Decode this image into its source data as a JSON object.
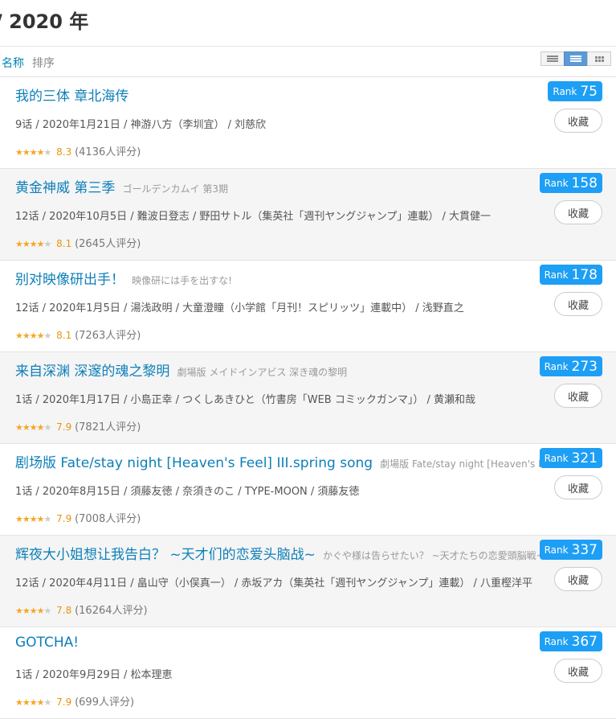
{
  "page": {
    "title": "/ 2020 年"
  },
  "sort": {
    "active": "名称",
    "other": "排序"
  },
  "view_modes": [
    "list-compact-icon",
    "list-detail-icon",
    "grid-icon"
  ],
  "actions": {
    "collect_label": "收藏",
    "rank_label": "Rank"
  },
  "items": [
    {
      "title": "我的三体 章北海传",
      "subtitle": "",
      "info": "9话 / 2020年1月21日 / 神游八方（李圳宜） / 刘慈欣",
      "stars": 4,
      "score": "8.3",
      "votes": "(4136人评分)",
      "rank": "75"
    },
    {
      "title": "黄金神威 第三季",
      "subtitle": "ゴールデンカムイ 第3期",
      "info": "12话 / 2020年10月5日 / 難波日登志 / 野田サトル（集英社「週刊ヤングジャンプ」連載） / 大貫健一",
      "stars": 4,
      "score": "8.1",
      "votes": "(2645人评分)",
      "rank": "158"
    },
    {
      "title": "别对映像研出手！",
      "subtitle": "映像研には手を出すな!",
      "info": "12话 / 2020年1月5日 / 湯浅政明 / 大童澄瞳（小学館「月刊！スピリッツ」連載中） / 浅野直之",
      "stars": 4,
      "score": "8.1",
      "votes": "(7263人评分)",
      "rank": "178"
    },
    {
      "title": "来自深渊 深邃的魂之黎明",
      "subtitle": "劇場版 メイドインアビス 深き魂の黎明",
      "info": "1话 / 2020年1月17日 / 小島正幸 / つくしあきひと（竹書房「WEB コミックガンマ」） / 黄瀬和哉",
      "stars": 4,
      "score": "7.9",
      "votes": "(7821人评分)",
      "rank": "273"
    },
    {
      "title": "剧场版 Fate/stay night [Heaven's Feel] III.spring song",
      "subtitle": "劇場版 Fate/stay night [Heaven's Feel] III.spring song",
      "info": "1话 / 2020年8月15日 / 須藤友徳 / 奈須きのこ / TYPE-MOON / 須藤友徳",
      "stars": 4,
      "score": "7.9",
      "votes": "(7008人评分)",
      "rank": "321"
    },
    {
      "title": "辉夜大小姐想让我告白？ ~天才们的恋爱头脑战~",
      "subtitle": "かぐや様は告らせたい？ ~天才たちの恋愛頭脳戦~",
      "info": "12话 / 2020年4月11日 / 畠山守（小俣真一） / 赤坂アカ（集英社「週刊ヤングジャンプ」連載） / 八重樫洋平",
      "stars": 4,
      "score": "7.8",
      "votes": "(16264人评分)",
      "rank": "337"
    },
    {
      "title": "GOTCHA!",
      "subtitle": "",
      "info": "1话 / 2020年9月29日 / 松本理恵",
      "stars": 4,
      "score": "7.9",
      "votes": "(699人评分)",
      "rank": "367"
    }
  ],
  "colors": {
    "link": "#0d7fb8",
    "rank_badge": "#1d9ff5",
    "star": "#f6a623",
    "score": "#e8960c"
  }
}
